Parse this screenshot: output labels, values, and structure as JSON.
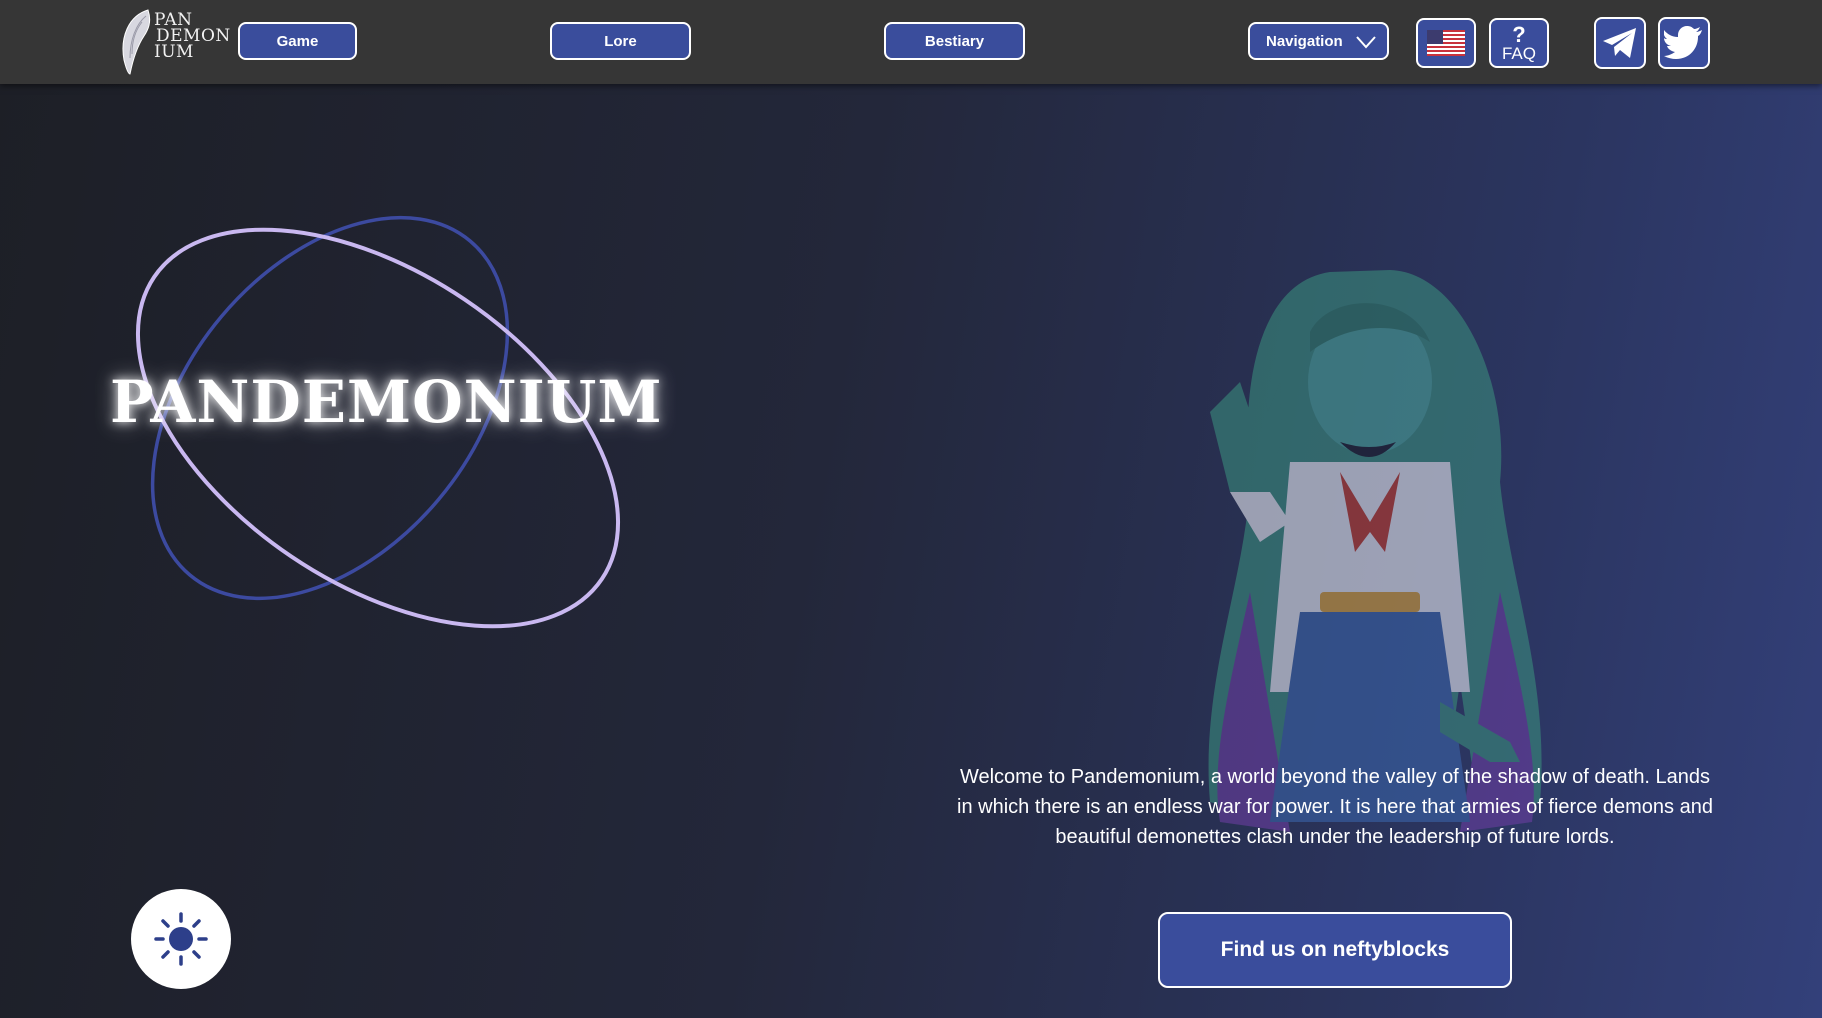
{
  "brand": {
    "logo_lines": [
      "PAN",
      "DEMON",
      "IUM"
    ]
  },
  "nav": {
    "game_label": "Game",
    "lore_label": "Lore",
    "bestiary_label": "Bestiary",
    "navigation_label": "Navigation",
    "faq_mark": "?",
    "faq_label": "FAQ",
    "language_icon": "us-flag-icon",
    "social_icons": [
      "telegram-icon",
      "twitter-icon"
    ]
  },
  "hero": {
    "title": "PANDEMONIUM",
    "intro": "Welcome to Pandemonium, a world beyond the valley of the shadow of death. Lands in which there is an endless war for power. It is here that armies of fierce demons and beautiful demonettes clash under the leadership of future lords.",
    "cta_label": "Find us on neftyblocks"
  },
  "theme": {
    "toggle_icon": "sun-icon"
  },
  "colors": {
    "header_bg": "#363636",
    "button_bg": "#3a4d9c",
    "orbit_light": "#c9b8f0",
    "orbit_dark": "#3c4aa0",
    "accent_text": "#ffffff"
  }
}
